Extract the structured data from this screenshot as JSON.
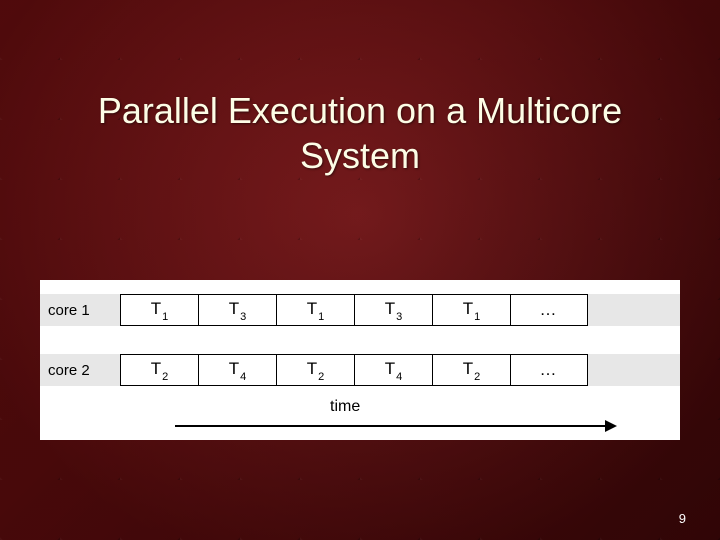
{
  "title_line1": "Parallel Execution on a Multicore",
  "title_line2": "System",
  "core1_label": "core 1",
  "core2_label": "core 2",
  "core1_cells": [
    "T1",
    "T3",
    "T1",
    "T3",
    "T1",
    "…"
  ],
  "core2_cells": [
    "T2",
    "T4",
    "T2",
    "T4",
    "T2",
    "…"
  ],
  "time_label": "time",
  "page_number": "9"
}
